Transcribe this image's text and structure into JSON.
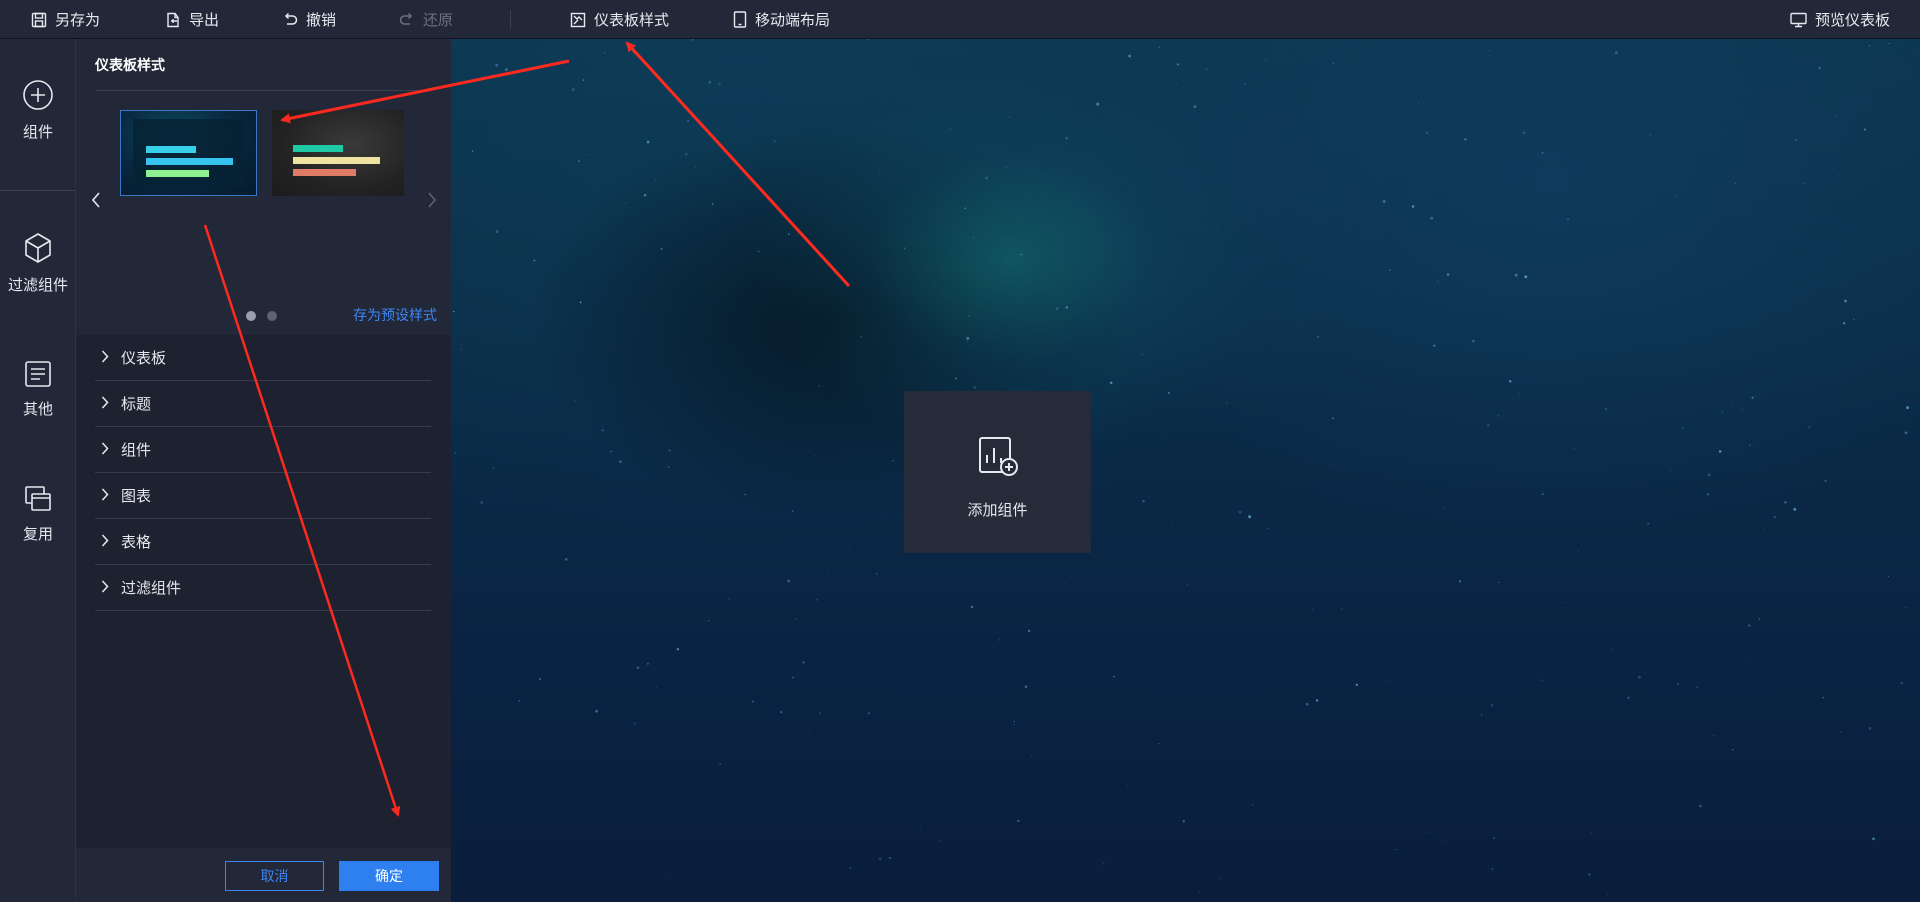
{
  "toolbar": {
    "save_as": "另存为",
    "export": "导出",
    "undo": "撤销",
    "redo": "还原",
    "dashboard_style": "仪表板样式",
    "mobile_layout": "移动端布局",
    "preview": "预览仪表板"
  },
  "rail": {
    "items": [
      {
        "label": "组件",
        "icon": "plus-circle-icon"
      },
      {
        "label": "过滤组件",
        "icon": "cube-icon"
      },
      {
        "label": "其他",
        "icon": "document-icon"
      },
      {
        "label": "复用",
        "icon": "copy-window-icon"
      }
    ]
  },
  "panel": {
    "title": "仪表板样式",
    "presets": [
      {
        "theme": "dark-blue",
        "selected": true,
        "bar_colors": [
          "#36d0ea",
          "#36c4ee",
          "#8ef08e"
        ]
      },
      {
        "theme": "dark-gray",
        "selected": false,
        "bar_colors": [
          "#1fc9a6",
          "#efe3a2",
          "#e07b68"
        ]
      }
    ],
    "page_count": 2,
    "current_page": 1,
    "save_preset": "存为预设样式",
    "sections": [
      "仪表板",
      "标题",
      "组件",
      "图表",
      "表格",
      "过滤组件"
    ],
    "cancel": "取消",
    "confirm": "确定"
  },
  "canvas": {
    "add_widget_label": "添加组件",
    "add_widget_icon": "chart-add-icon"
  },
  "colors": {
    "accent": "#3d86f2",
    "primary_button": "#2e7ff0",
    "annotation": "#ff2a1f"
  }
}
